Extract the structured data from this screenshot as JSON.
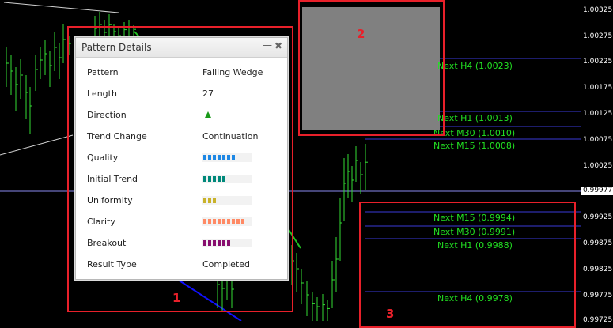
{
  "price_scale": [
    "1.00325",
    "1.00275",
    "1.00225",
    "1.00175",
    "1.00125",
    "1.00075",
    "1.00025",
    "0.99925",
    "0.99875",
    "0.99825",
    "0.99775",
    "0.99725"
  ],
  "current_price": "0.99977",
  "levels_above": [
    {
      "label": "Next H4 (1.0023)"
    },
    {
      "label": "Next H1 (1.0013)"
    },
    {
      "label": "Next M30 (1.0010)"
    },
    {
      "label": "Next M15 (1.0008)"
    }
  ],
  "levels_below": [
    {
      "label": "Next M15 (0.9994)"
    },
    {
      "label": "Next M30 (0.9991)"
    },
    {
      "label": "Next H1 (0.9988)"
    },
    {
      "label": "Next H4 (0.9978)"
    }
  ],
  "box_numbers": {
    "box1": "1",
    "box2": "2",
    "box3": "3"
  },
  "panel": {
    "title": "Pattern Details",
    "min_icon": "minimize-icon",
    "close_icon": "close-icon",
    "rows": [
      {
        "label": "Pattern",
        "value": "Falling Wedge"
      },
      {
        "label": "Length",
        "value": "27"
      },
      {
        "label": "Direction",
        "value": ""
      },
      {
        "label": "Trend Change",
        "value": "Continuation"
      },
      {
        "label": "Quality",
        "value": ""
      },
      {
        "label": "Initial Trend",
        "value": ""
      },
      {
        "label": "Uniformity",
        "value": ""
      },
      {
        "label": "Clarity",
        "value": ""
      },
      {
        "label": "Breakout",
        "value": ""
      },
      {
        "label": "Result Type",
        "value": "Completed"
      }
    ],
    "direction_icon": "up-arrow-icon",
    "ratings": {
      "quality": {
        "filled": 7,
        "of": 10,
        "color": "#1e88e5"
      },
      "initial_trend": {
        "filled": 5,
        "of": 10,
        "color": "#00897b"
      },
      "uniformity": {
        "filled": 3,
        "of": 10,
        "color": "#c9b22a"
      },
      "clarity": {
        "filled": 9,
        "of": 10,
        "color": "#ff8a65"
      },
      "breakout": {
        "filled": 6,
        "of": 10,
        "color": "#880e6f"
      }
    }
  },
  "colors": {
    "candles": "#33dd33",
    "level_line": "#3a3ad8",
    "marker": "#e8202a",
    "blue_trend": "#1010ff"
  }
}
